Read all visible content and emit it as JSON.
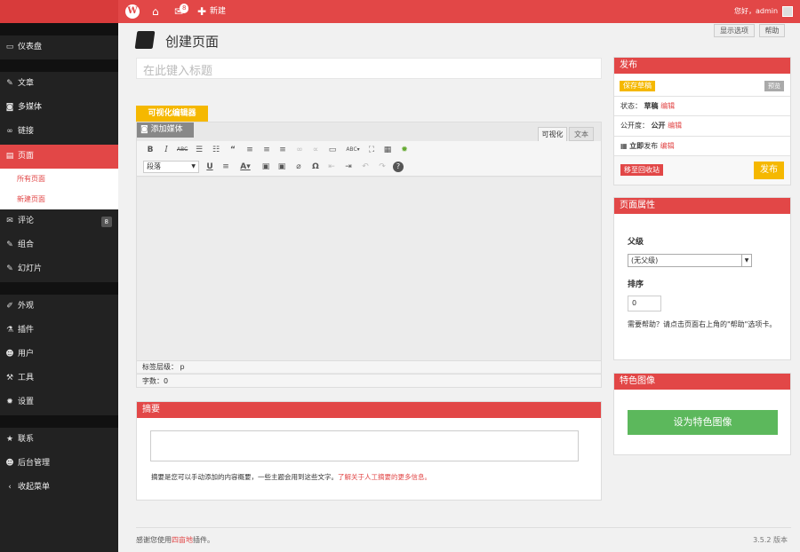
{
  "topbar": {
    "comments_count": "8",
    "new_label": "新建",
    "greeting": "您好，admin"
  },
  "sidebar": {
    "dashboard": "仪表盘",
    "posts": "文章",
    "media": "多媒体",
    "links": "链接",
    "pages": "页面",
    "all_pages": "所有页面",
    "new_page": "新建页面",
    "comments": "评论",
    "comments_count": "8",
    "portfolio": "组合",
    "slides": "幻灯片",
    "appearance": "外观",
    "plugins": "插件",
    "users": "用户",
    "tools": "工具",
    "settings": "设置",
    "contact": "联系",
    "admin": "后台管理",
    "collapse": "收起菜单"
  },
  "screen_options": "显示选项",
  "help": "帮助",
  "page_title": "创建页面",
  "title_placeholder": "在此键入标题",
  "editor": {
    "visual_editor_tab": "可视化编辑器",
    "add_media": "添加媒体",
    "tab_visual": "可视化",
    "tab_text": "文本",
    "format_select": "段落",
    "path_label": "标签层级：",
    "path_value": "p",
    "word_count": "字数：0"
  },
  "excerpt": {
    "title": "摘要",
    "help_text": "摘要是您可以手动添加的内容概要，一些主题会用到这些文字。",
    "help_link": "了解关于人工摘要的更多信息。"
  },
  "publish": {
    "title": "发布",
    "save_draft": "保存草稿",
    "preview": "预览",
    "status_label": "状态：",
    "status_value": "草稿",
    "edit": "编辑",
    "visibility_label": "公开度：",
    "visibility_value": "公开",
    "publish_time": "立即",
    "publish_time_suffix": "发布",
    "trash": "移至回收站",
    "publish_button": "发布"
  },
  "page_attributes": {
    "title": "页面属性",
    "parent_label": "父级",
    "parent_value": "(无父级)",
    "order_label": "排序",
    "order_value": "0",
    "help_text": "需要帮助？请点击页面右上角的\"帮助\"选项卡。"
  },
  "featured_image": {
    "title": "特色图像",
    "button": "设为特色图像"
  },
  "footer": {
    "thanks_prefix": "感谢您使用",
    "thanks_link": "四亩地",
    "thanks_suffix": "插件。",
    "version": "3.5.2 版本"
  },
  "colors": {
    "accent": "#e24747",
    "dark": "#222222",
    "yellow": "#f5b800",
    "green": "#5cb85c"
  }
}
